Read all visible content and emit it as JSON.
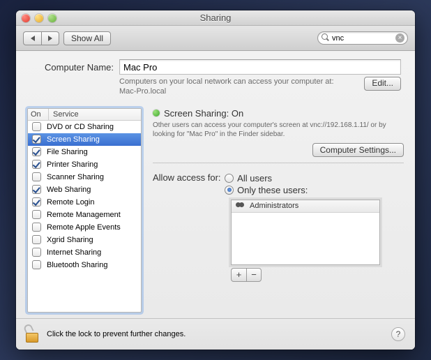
{
  "window": {
    "title": "Sharing"
  },
  "toolbar": {
    "show_all": "Show All",
    "search_value": "vnc"
  },
  "computer_name": {
    "label": "Computer Name:",
    "value": "Mac Pro",
    "hint_line1": "Computers on your local network can access your computer at:",
    "hint_line2": "Mac-Pro.local",
    "edit": "Edit..."
  },
  "services": {
    "col_on": "On",
    "col_service": "Service",
    "items": [
      {
        "label": "DVD or CD Sharing",
        "on": false
      },
      {
        "label": "Screen Sharing",
        "on": true,
        "selected": true
      },
      {
        "label": "File Sharing",
        "on": true
      },
      {
        "label": "Printer Sharing",
        "on": true
      },
      {
        "label": "Scanner Sharing",
        "on": false
      },
      {
        "label": "Web Sharing",
        "on": true
      },
      {
        "label": "Remote Login",
        "on": true
      },
      {
        "label": "Remote Management",
        "on": false
      },
      {
        "label": "Remote Apple Events",
        "on": false
      },
      {
        "label": "Xgrid Sharing",
        "on": false
      },
      {
        "label": "Internet Sharing",
        "on": false
      },
      {
        "label": "Bluetooth Sharing",
        "on": false
      }
    ]
  },
  "detail": {
    "status": "Screen Sharing: On",
    "desc": "Other users can access your computer's screen at vnc://192.168.1.11/ or by looking for \"Mac Pro\" in the Finder sidebar.",
    "computer_settings": "Computer Settings...",
    "allow_label": "Allow access for:",
    "opt_all": "All users",
    "opt_only": "Only these users:",
    "selected_option": "only",
    "users": [
      "Administrators"
    ]
  },
  "footer": {
    "lock_text": "Click the lock to prevent further changes."
  }
}
